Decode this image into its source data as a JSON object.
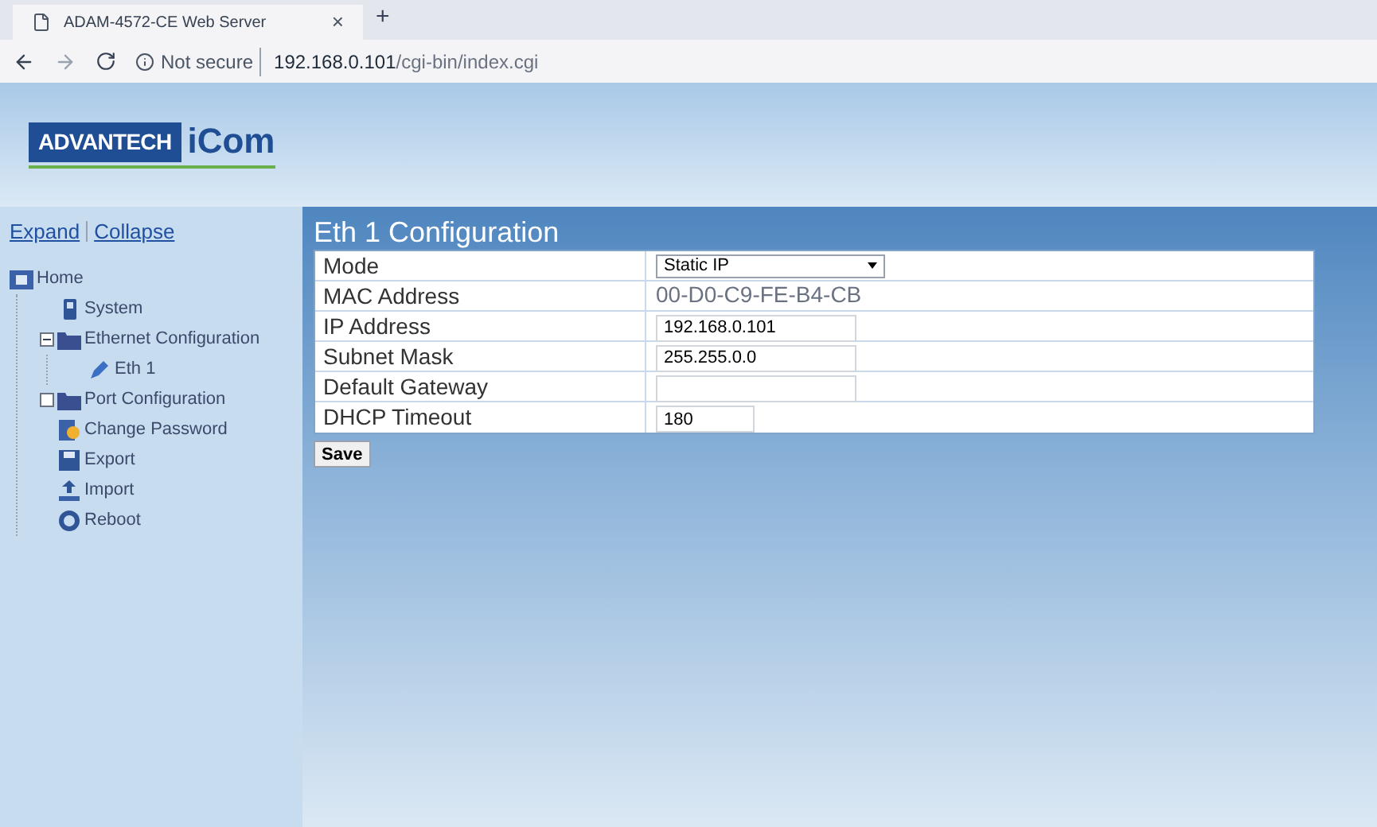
{
  "browser": {
    "tab_title": "ADAM-4572-CE Web Server",
    "close": "×",
    "new_tab": "+",
    "security": "Not secure",
    "url_host": "192.168.0.101",
    "url_path": "/cgi-bin/index.cgi"
  },
  "header": {
    "logo_brand": "ADVANTECH",
    "logo_product": "iCom"
  },
  "sidebar": {
    "expand": "Expand",
    "collapse": "Collapse",
    "tree": [
      {
        "label": "Home",
        "kind": "home",
        "children": [
          {
            "label": "System",
            "kind": "system"
          },
          {
            "label": "Ethernet Configuration",
            "kind": "folder",
            "expanded": true,
            "children": [
              {
                "label": "Eth 1",
                "kind": "pen"
              }
            ]
          },
          {
            "label": "Port Configuration",
            "kind": "folder",
            "expanded": false
          },
          {
            "label": "Change Password",
            "kind": "password"
          },
          {
            "label": "Export",
            "kind": "export"
          },
          {
            "label": "Import",
            "kind": "import"
          },
          {
            "label": "Reboot",
            "kind": "reboot"
          }
        ]
      }
    ]
  },
  "main": {
    "title": "Eth 1 Configuration",
    "rows": [
      {
        "label": "Mode",
        "kind": "select",
        "value": "Static IP"
      },
      {
        "label": "MAC Address",
        "kind": "static",
        "value": "00-D0-C9-FE-B4-CB"
      },
      {
        "label": "IP Address",
        "kind": "input",
        "value": "192.168.0.101"
      },
      {
        "label": "Subnet Mask",
        "kind": "input",
        "value": "255.255.0.0"
      },
      {
        "label": "Default Gateway",
        "kind": "input",
        "value": ""
      },
      {
        "label": "DHCP Timeout",
        "kind": "short",
        "value": "180"
      }
    ],
    "save": "Save"
  }
}
